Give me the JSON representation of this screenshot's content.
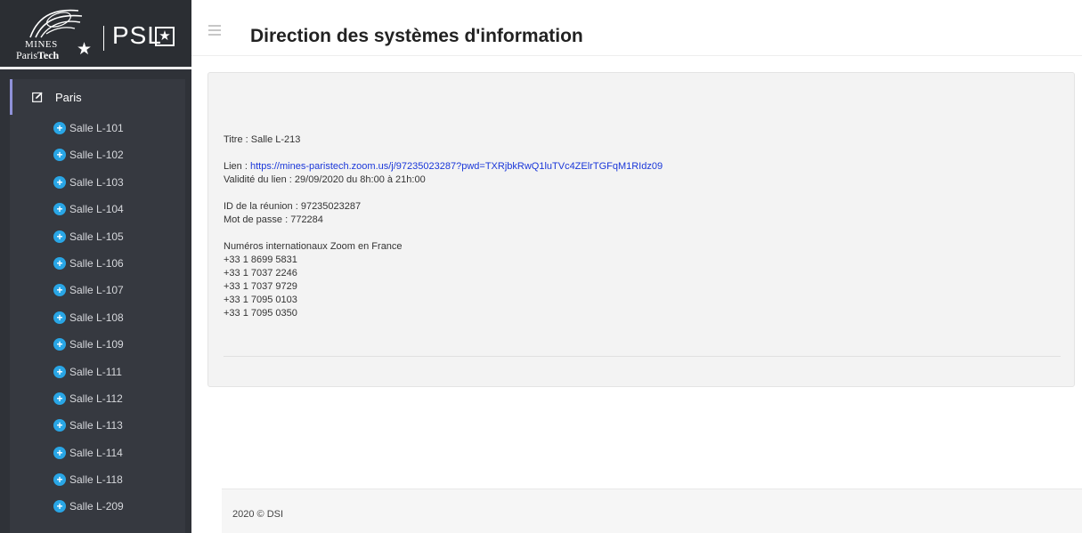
{
  "branding": {
    "mines_line1": "MINES",
    "paristech_prefix": "Paris",
    "paristech_bold": "Tech",
    "mines_star": "★",
    "psl_text": "PSL",
    "psl_star": "★"
  },
  "header": {
    "title": "Direction des systèmes d'information"
  },
  "sidebar": {
    "group_label": "Paris",
    "items": [
      {
        "label": "Salle L-101"
      },
      {
        "label": "Salle L-102"
      },
      {
        "label": "Salle L-103"
      },
      {
        "label": "Salle L-104"
      },
      {
        "label": "Salle L-105"
      },
      {
        "label": "Salle L-106"
      },
      {
        "label": "Salle L-107"
      },
      {
        "label": "Salle L-108"
      },
      {
        "label": "Salle L-109"
      },
      {
        "label": "Salle L-111"
      },
      {
        "label": "Salle L-112"
      },
      {
        "label": "Salle L-113"
      },
      {
        "label": "Salle L-114"
      },
      {
        "label": "Salle L-118"
      },
      {
        "label": "Salle L-209"
      }
    ],
    "plus_glyph": "+"
  },
  "meeting": {
    "titre": "Titre : Salle L-213",
    "lien_label": "Lien : ",
    "lien_url": "https://mines-paristech.zoom.us/j/97235023287?pwd=TXRjbkRwQ1luTVc4ZElrTGFqM1RIdz09",
    "validite": "Validité du lien : 29/09/2020 du 8h:00 à 21h:00",
    "meeting_id": "ID de la réunion : 97235023287",
    "password": "Mot de passe : 772284",
    "numbers_heading": "Numéros internationaux Zoom en France",
    "numbers": [
      "+33 1 8699 5831",
      "+33 1 7037 2246",
      "+33 1 7037 9729",
      "+33 1 7095 0103",
      "+33 1 7095 0350"
    ]
  },
  "footer": {
    "text": "2020 © DSI"
  },
  "colors": {
    "sidebar_bg": "#2f3238",
    "nav_bg": "#363940",
    "accent": "#8f91d8",
    "plus_icon": "#29a6e6",
    "link": "#1a37d9"
  }
}
